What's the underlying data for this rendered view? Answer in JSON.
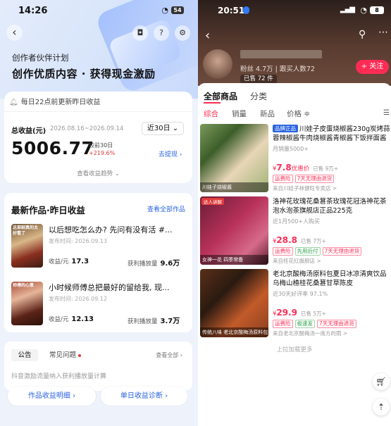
{
  "left": {
    "status": {
      "time": "14:26",
      "battery": "54"
    },
    "header": {
      "subtitle": "创作者伙伴计划",
      "title": "创作优质内容 · 获得现金激励"
    },
    "notice": "每日22点前更新昨日收益",
    "total": {
      "label": "总收益(元)",
      "range": "2026.08.16~2026.09.14",
      "period": "近30日",
      "amount": "5006.77",
      "compare_label": "较前30日",
      "compare_pct": "+219.6%",
      "withdraw": "去提现",
      "trend": "查看收益趋势"
    },
    "works": {
      "title": "最新作品·昨日收益",
      "view_all": "查看全部作品",
      "items": [
        {
          "title": "以后想吃怎么办? 先问有没有活 #...",
          "date": "发布时间: 2026.09.13",
          "earn_label": "收益/元",
          "earn": "17.3",
          "play_label": "获利播放量",
          "play": "9.6万",
          "thumb_text": "这部剧真的太好看了"
        },
        {
          "title": "小时候师傅总把最好的留给我, 现...",
          "date": "发布时间: 2026.09.12",
          "earn_label": "收益/元",
          "earn": "12.13",
          "play_label": "获利播放量",
          "play": "3.7万",
          "thumb_text": "师傅的心意"
        }
      ]
    },
    "announce": {
      "tab1": "公告",
      "tab2": "常见问题",
      "see_all": "查看全部",
      "faq": "抖音激励流量纳入获利播放量计算"
    },
    "buttons": {
      "detail": "作品收益明细",
      "diagnose": "单日收益诊断"
    }
  },
  "right": {
    "status": {
      "time": "20:51",
      "battery": "8"
    },
    "shop": {
      "fans": "粉丝 4.7万  |  跟买人数72",
      "sold": "已售 72 件",
      "follow": "+ 关注"
    },
    "tabs": {
      "all": "全部商品",
      "category": "分类"
    },
    "sort": [
      "综合",
      "销量",
      "新品",
      "价格 ≑"
    ],
    "products": [
      {
        "badge": "品牌正品",
        "title": "川娃子皮蛋烧椒酱230g炭烤蒜蓉辣椒酱牛肉烧椒酱青椒酱下饭拌面酱",
        "sub": "月销量5000+",
        "price": "7.8",
        "price_tag": "优惠价",
        "sold": "已售 9万+",
        "tags": [
          "运费险",
          "7天无理由退货"
        ],
        "shop": "来自川娃子林健旺专卖店 >",
        "img_text": "川娃子烧椒酱",
        "img_tag": ""
      },
      {
        "badge": "",
        "title": "洛神花玫瑰花桑葚茶玫瑰花冠洛神花茶泡水泡茶旗舰店正品225克",
        "sub": "近1月500+人购买",
        "price": "28.8",
        "price_tag": "",
        "sold": "已售 7万+",
        "tags": [
          "运费险",
          "先用后付",
          "7天无理由退货"
        ],
        "shop": "来自桂花红旗舰店 >",
        "img_text": "女神一花 四季常备",
        "img_tag": "达人讲解"
      },
      {
        "badge": "",
        "title": "老北京酸梅汤原料包夏日冰凉清爽饮品乌梅山楂桂花桑葚甘草陈皮",
        "sub": "近30天好评率 97.1%",
        "price": "29.9",
        "price_tag": "",
        "sold": "已售 5万+",
        "tags": [
          "运费险",
          "极速发",
          "7天无理由退货"
        ],
        "shop": "来自老北京酸梅汤一南方的雨 >",
        "img_text": "传统八味 老北京酸梅汤原料包",
        "img_tag": ""
      }
    ],
    "load_more": "上拉加载更多"
  }
}
